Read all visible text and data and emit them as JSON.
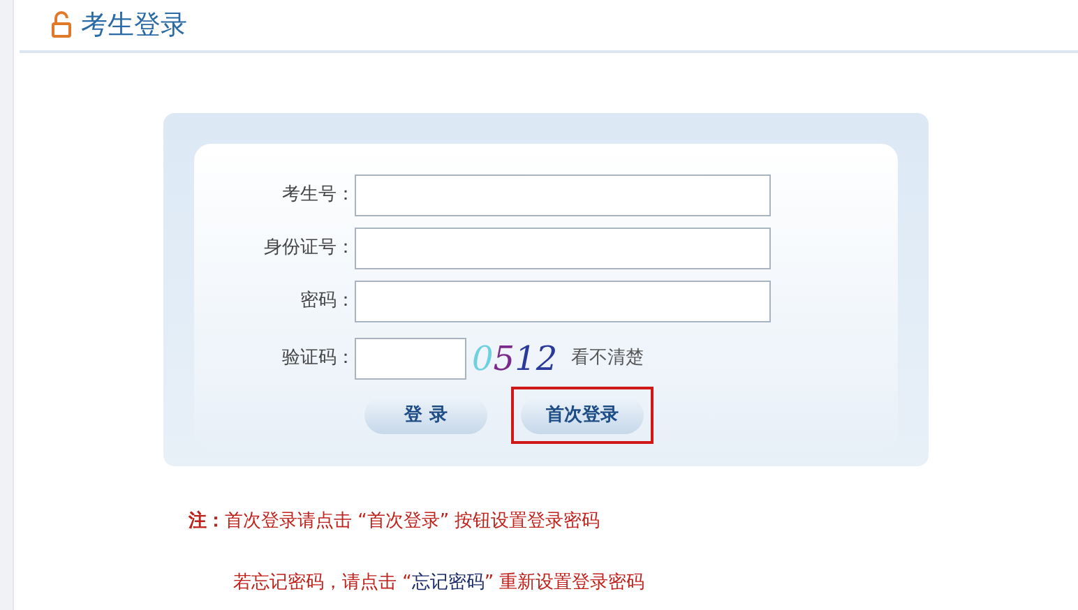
{
  "header": {
    "title": "考生登录"
  },
  "form": {
    "fields": [
      {
        "label": "考生号：",
        "kind": "text"
      },
      {
        "label": "身份证号：",
        "kind": "text"
      },
      {
        "label": "密码：",
        "kind": "password"
      },
      {
        "label": "验证码：",
        "kind": "captcha",
        "captcha": "0512",
        "refresh_link": "看不清楚"
      }
    ],
    "buttons": [
      {
        "label": "登 录",
        "highlighted": false
      },
      {
        "label": "首次登录",
        "highlighted": true
      }
    ]
  },
  "notes": [
    {
      "text": "**注：**首次登录请点击 “首次登录” 按钮设置登录密码"
    },
    {
      "before": "若忘记密码，请点击 “",
      "link": "忘记密码",
      "after": "” 重新设置登录密码"
    }
  ]
}
